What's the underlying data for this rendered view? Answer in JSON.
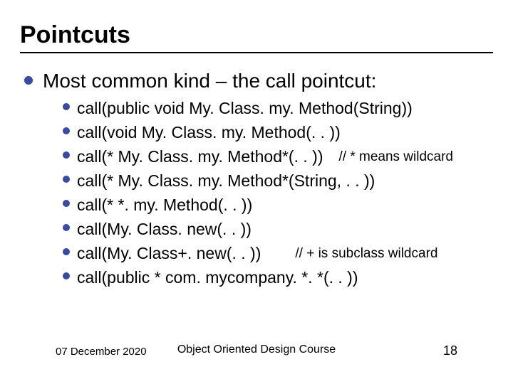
{
  "title": "Pointcuts",
  "l1_text": "Most common kind – the call pointcut:",
  "items": {
    "i0": "call(public void My. Class. my. Method(String))",
    "i1": "call(void My. Class. my. Method(. . ))",
    "i2": "call(* My. Class. my. Method*(. . ))",
    "i2_comment": "// * means wildcard",
    "i3": "call(* My. Class. my. Method*(String, . . ))",
    "i4": "call(* *. my. Method(. . ))",
    "i5": "call(My. Class. new(. . ))",
    "i6": "call(My. Class+. new(. . ))",
    "i6_comment": "// + is subclass wildcard",
    "i7": "call(public * com. mycompany. *. *(. . ))"
  },
  "footer": {
    "date": "07 December 2020",
    "course": "Object Oriented Design Course",
    "page": "18"
  }
}
